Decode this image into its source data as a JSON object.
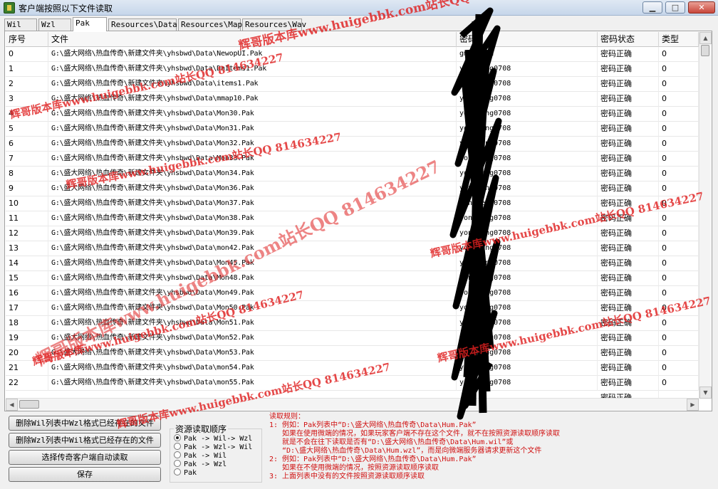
{
  "window": {
    "title": "客户端按照以下文件读取",
    "min_glyph": "▁",
    "max_glyph": "□",
    "close_glyph": "✕"
  },
  "tabs": [
    "Wil",
    "Wzl",
    "Pak",
    "Resources\\Data",
    "Resources\\Map",
    "Resources\\Wav"
  ],
  "active_tab": 2,
  "table": {
    "headers": [
      "序号",
      "文件",
      "密码",
      "密码状态",
      "类型"
    ],
    "rows": [
      [
        "0",
        "G:\\盛大网络\\热血传奇\\新建文件夹\\yhsbwd\\Data\\NewopUI.Pak",
        "gm1admin",
        "密码正确",
        "0"
      ],
      [
        "1",
        "G:\\盛大网络\\热血传奇\\新建文件夹\\yhsbwd\\Data\\DnItems1.Pak",
        "yongheng0708",
        "密码正确",
        "0"
      ],
      [
        "2",
        "G:\\盛大网络\\热血传奇\\新建文件夹\\yhsbwd\\Data\\items1.Pak",
        "yongheng0708",
        "密码正确",
        "0"
      ],
      [
        "3",
        "G:\\盛大网络\\热血传奇\\新建文件夹\\yhsbwd\\Data\\mmap10.Pak",
        "yongheng0708",
        "密码正确",
        "0"
      ],
      [
        "4",
        "G:\\盛大网络\\热血传奇\\新建文件夹\\yhsbwd\\Data\\Mon30.Pak",
        "yongheng0708",
        "密码正确",
        "0"
      ],
      [
        "5",
        "G:\\盛大网络\\热血传奇\\新建文件夹\\yhsbwd\\Data\\Mon31.Pak",
        "yongheng0708",
        "密码正确",
        "0"
      ],
      [
        "6",
        "G:\\盛大网络\\热血传奇\\新建文件夹\\yhsbwd\\Data\\Mon32.Pak",
        "yongheng0708",
        "密码正确",
        "0"
      ],
      [
        "7",
        "G:\\盛大网络\\热血传奇\\新建文件夹\\yhsbwd\\Data\\Mon33.Pak",
        "yongheng0708",
        "密码正确",
        "0"
      ],
      [
        "8",
        "G:\\盛大网络\\热血传奇\\新建文件夹\\yhsbwd\\Data\\Mon34.Pak",
        "yongheng0708",
        "密码正确",
        "0"
      ],
      [
        "9",
        "G:\\盛大网络\\热血传奇\\新建文件夹\\yhsbwd\\Data\\Mon36.Pak",
        "yongheng0708",
        "密码正确",
        "0"
      ],
      [
        "10",
        "G:\\盛大网络\\热血传奇\\新建文件夹\\yhsbwd\\Data\\Mon37.Pak",
        "yongheng0708",
        "密码正确",
        "0"
      ],
      [
        "11",
        "G:\\盛大网络\\热血传奇\\新建文件夹\\yhsbwd\\Data\\Mon38.Pak",
        "yongheng0708",
        "密码正确",
        "0"
      ],
      [
        "12",
        "G:\\盛大网络\\热血传奇\\新建文件夹\\yhsbwd\\Data\\Mon39.Pak",
        "yongheng0708",
        "密码正确",
        "0"
      ],
      [
        "13",
        "G:\\盛大网络\\热血传奇\\新建文件夹\\yhsbwd\\Data\\mon42.Pak",
        "yongheng0708",
        "密码正确",
        "0"
      ],
      [
        "14",
        "G:\\盛大网络\\热血传奇\\新建文件夹\\yhsbwd\\Data\\Mon45.Pak",
        "yongheng0708",
        "密码正确",
        "0"
      ],
      [
        "15",
        "G:\\盛大网络\\热血传奇\\新建文件夹\\yhsbwd\\Data\\Mon48.Pak",
        "yongheng0708",
        "密码正确",
        "0"
      ],
      [
        "16",
        "G:\\盛大网络\\热血传奇\\新建文件夹\\yhsbwd\\Data\\Mon49.Pak",
        "yongheng0708",
        "密码正确",
        "0"
      ],
      [
        "17",
        "G:\\盛大网络\\热血传奇\\新建文件夹\\yhsbwd\\Data\\Mon50.Pak",
        "yongheng0708",
        "密码正确",
        "0"
      ],
      [
        "18",
        "G:\\盛大网络\\热血传奇\\新建文件夹\\yhsbwd\\Data\\Mon51.Pak",
        "yongheng0708",
        "密码正确",
        "0"
      ],
      [
        "19",
        "G:\\盛大网络\\热血传奇\\新建文件夹\\yhsbwd\\Data\\Mon52.Pak",
        "yongheng0708",
        "密码正确",
        "0"
      ],
      [
        "20",
        "G:\\盛大网络\\热血传奇\\新建文件夹\\yhsbwd\\Data\\Mon53.Pak",
        "yongheng0708",
        "密码正确",
        "0"
      ],
      [
        "21",
        "G:\\盛大网络\\热血传奇\\新建文件夹\\yhsbwd\\Data\\mon54.Pak",
        "yongheng0708",
        "密码正确",
        "0"
      ],
      [
        "22",
        "G:\\盛大网络\\热血传奇\\新建文件夹\\yhsbwd\\Data\\mon55.Pak",
        "yongheng0708",
        "密码正确",
        "0"
      ]
    ],
    "partial_row_status": "密码正确"
  },
  "buttons": {
    "delete_wil": "删除Wil列表中Wzl格式已经存在的文件",
    "delete_wzl": "删除Wzl列表中Wil格式已经存在的文件",
    "select_client": "选择传奇客户端自动读取",
    "save": "保存"
  },
  "resource_order": {
    "title": "资源读取顺序",
    "selected": 0,
    "options": [
      "Pak -> Wil-> Wzl",
      "Pak -> Wzl-> Wil",
      "Pak -> Wil",
      "Pak -> Wzl",
      "Pak"
    ]
  },
  "rules": {
    "title": "读取规则：",
    "lines": [
      "1: 例如：Pak列表中“D:\\盛大网络\\热血传奇\\Data\\Hum.Pak”",
      "如果在使用微端的情况，如果玩家客户端不存在这个文件，就不在按照资源读取顺序读取",
      "就是不会在往下读取是否有“D:\\盛大网络\\热血传奇\\Data\\Hum.wil”或",
      "“D:\\盛大网络\\热血传奇\\Data\\Hum.wzl”，而是向微端服务器请求更新这个文件",
      "2: 例如：Pak列表中“D:\\盛大网络\\热血传奇\\Data\\Hum.Pak”",
      "如果在不使用微端的情况，按照资源读取顺序读取",
      "3: 上面列表中没有的文件按照资源读取顺序读取"
    ]
  },
  "watermarks": [
    "辉哥版本库www.huigebbk.com站长QQ 814634227",
    "辉哥版本库www.huigebbk.com站长QQ 814634227",
    "辉哥版本库www.huigebbk.com站长QQ 814634227",
    "辉哥版本库www.huigebbk.com站长QQ 814634227",
    "辉哥版本库www.huigebbk.com站长QQ 814634227",
    "辉哥版本库www.huigebbk.com站长QQ 814634227",
    "辉哥版本库www.huigebbk.com站长QQ 814634227",
    "辉哥版本库www.huigebbk.com站长QQ 814634227"
  ],
  "colors": {
    "watermark": "#e02020",
    "rules_text": "#d01010",
    "redaction": "#000000"
  }
}
